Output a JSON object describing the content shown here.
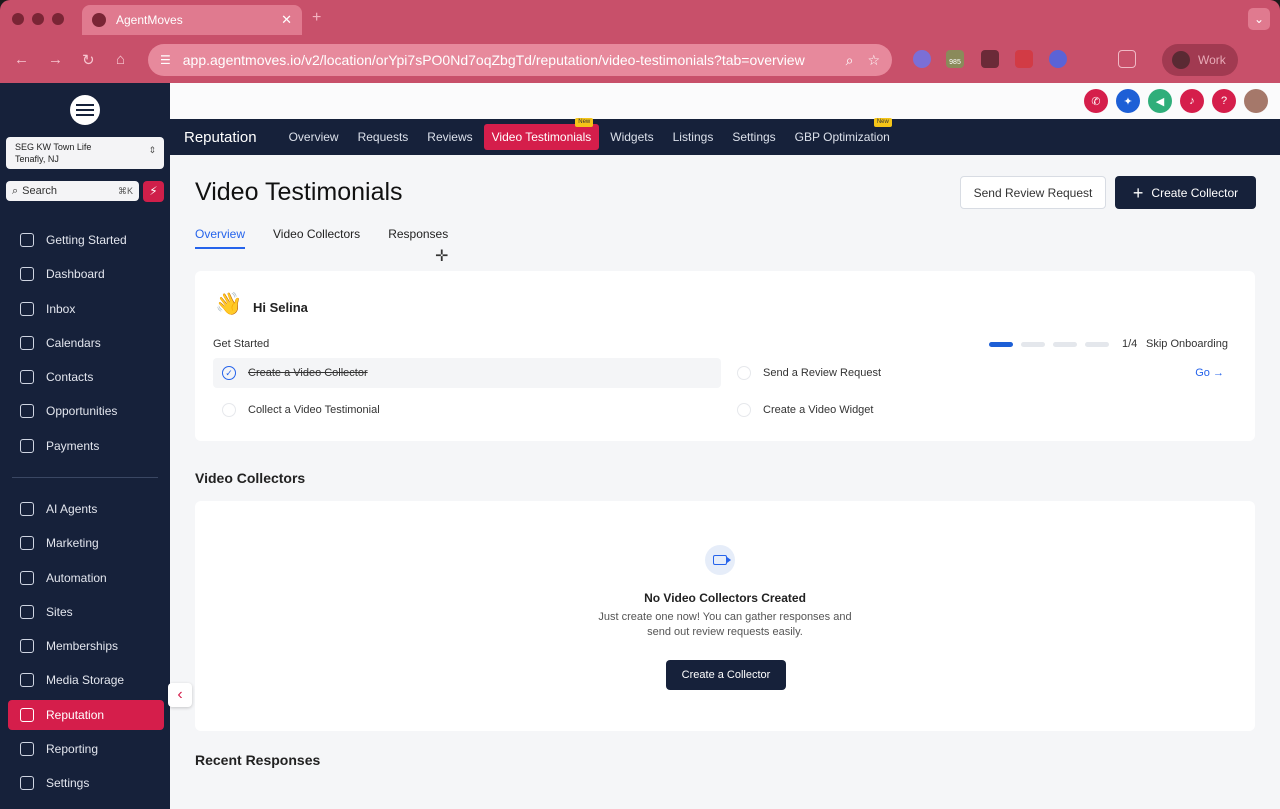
{
  "browser": {
    "tab_title": "AgentMoves",
    "url": "app.agentmoves.io/v2/location/orYpi7sPO0Nd7oqZbgTd/reputation/video-testimonials?tab=overview",
    "profile_label": "Work",
    "extension_badge": "985"
  },
  "sidebar": {
    "location_name": "SEG KW Town Life",
    "location_city": "Tenafly, NJ",
    "search_label": "Search",
    "search_shortcut": "⌘K",
    "items_top": [
      {
        "label": "Getting Started"
      },
      {
        "label": "Dashboard"
      },
      {
        "label": "Inbox"
      },
      {
        "label": "Calendars"
      },
      {
        "label": "Contacts"
      },
      {
        "label": "Opportunities"
      },
      {
        "label": "Payments"
      }
    ],
    "items_bottom": [
      {
        "label": "AI Agents"
      },
      {
        "label": "Marketing"
      },
      {
        "label": "Automation"
      },
      {
        "label": "Sites"
      },
      {
        "label": "Memberships"
      },
      {
        "label": "Media Storage"
      },
      {
        "label": "Reputation"
      },
      {
        "label": "Reporting"
      },
      {
        "label": "Settings"
      }
    ]
  },
  "subnav": {
    "brand": "Reputation",
    "items": [
      "Overview",
      "Requests",
      "Reviews",
      "Video Testimonials",
      "Widgets",
      "Listings",
      "Settings",
      "GBP Optimization"
    ],
    "new_badge": "New"
  },
  "page": {
    "title": "Video Testimonials",
    "send_review_request": "Send Review Request",
    "create_collector": "Create Collector",
    "tabs": [
      "Overview",
      "Video Collectors",
      "Responses"
    ]
  },
  "onboarding": {
    "greeting": "Hi Selina",
    "get_started": "Get Started",
    "progress": "1/4",
    "progress_value": 1,
    "progress_total": 4,
    "skip": "Skip Onboarding",
    "tasks": [
      {
        "label": "Create a Video Collector",
        "done": true
      },
      {
        "label": "Send a Review Request",
        "done": false
      },
      {
        "label": "Collect a Video Testimonial",
        "done": false
      },
      {
        "label": "Create a Video Widget",
        "done": false
      }
    ],
    "go_label": "Go"
  },
  "video_collectors": {
    "title": "Video Collectors",
    "empty_title": "No Video Collectors Created",
    "empty_line1": "Just create one now! You can gather responses and",
    "empty_line2": "send out review requests easily.",
    "button": "Create a Collector"
  },
  "recent_responses": {
    "title": "Recent Responses"
  },
  "colors": {
    "accent": "#d51e4b",
    "navy": "#16213a",
    "link_blue": "#2563eb",
    "chrome": "#c8506a"
  }
}
